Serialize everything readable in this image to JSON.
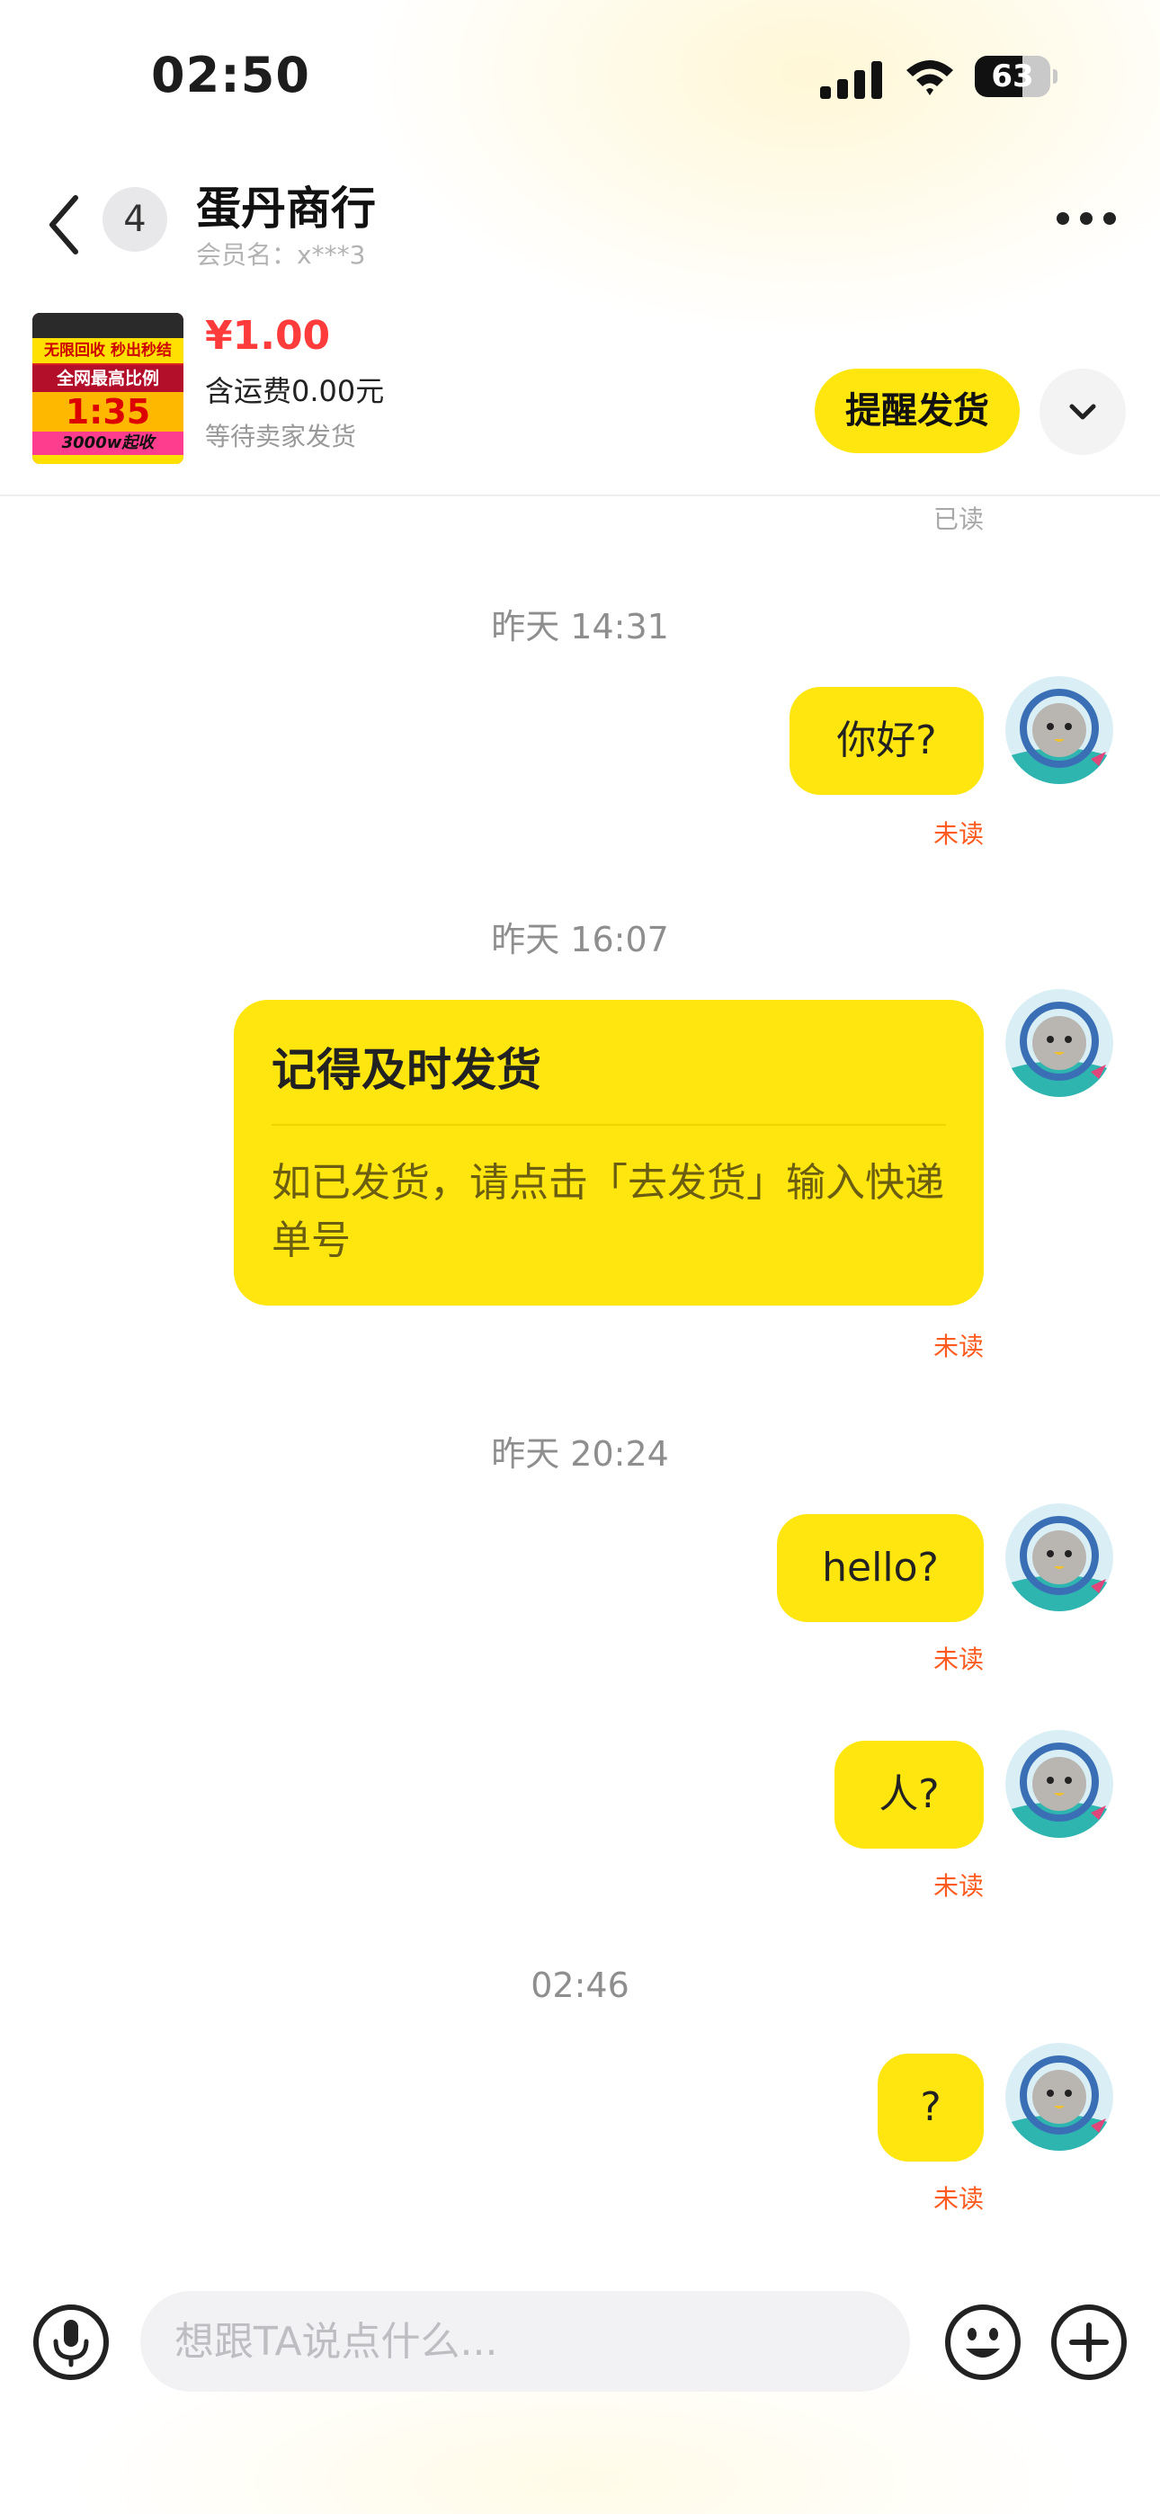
{
  "status_bar": {
    "time": "02:50",
    "battery": "63",
    "battery_level": 0.63
  },
  "header": {
    "unread_count": "4",
    "title": "蛋丹商行",
    "member_label": "会员名：x***3"
  },
  "product": {
    "image_text": [
      "无限回收 秒出秒结",
      "全网最高比例",
      "1:35",
      "3000w起收"
    ],
    "price": "¥1.00",
    "shipping": "含运费0.00元",
    "status": "等待卖家发货",
    "remind_button": "提醒发货"
  },
  "chat": {
    "top_read_status": "已读",
    "groups": [
      {
        "time": "昨天 14:31",
        "messages": [
          {
            "text": "你好?",
            "status": "未读"
          }
        ]
      },
      {
        "time": "昨天 16:07",
        "card": {
          "title": "记得及时发货",
          "body": "如已发货，请点击「去发货」输入快递单号",
          "status": "未读"
        }
      },
      {
        "time": "昨天 20:24",
        "messages": [
          {
            "text": "hello?",
            "status": "未读"
          },
          {
            "text": "人?",
            "status": "未读"
          }
        ]
      },
      {
        "time": "02:46",
        "messages": [
          {
            "text": "?",
            "status": "未读"
          }
        ]
      }
    ]
  },
  "input": {
    "placeholder": "想跟TA说点什么..."
  },
  "colors": {
    "accent": "#ffe60f",
    "price": "#ff3b3b",
    "unread": "#ff5a1f"
  },
  "icons": [
    "back-icon",
    "more-icon",
    "chevron-down-icon",
    "microphone-icon",
    "emoji-icon",
    "plus-icon",
    "wifi-icon",
    "signal-icon",
    "battery-icon"
  ]
}
